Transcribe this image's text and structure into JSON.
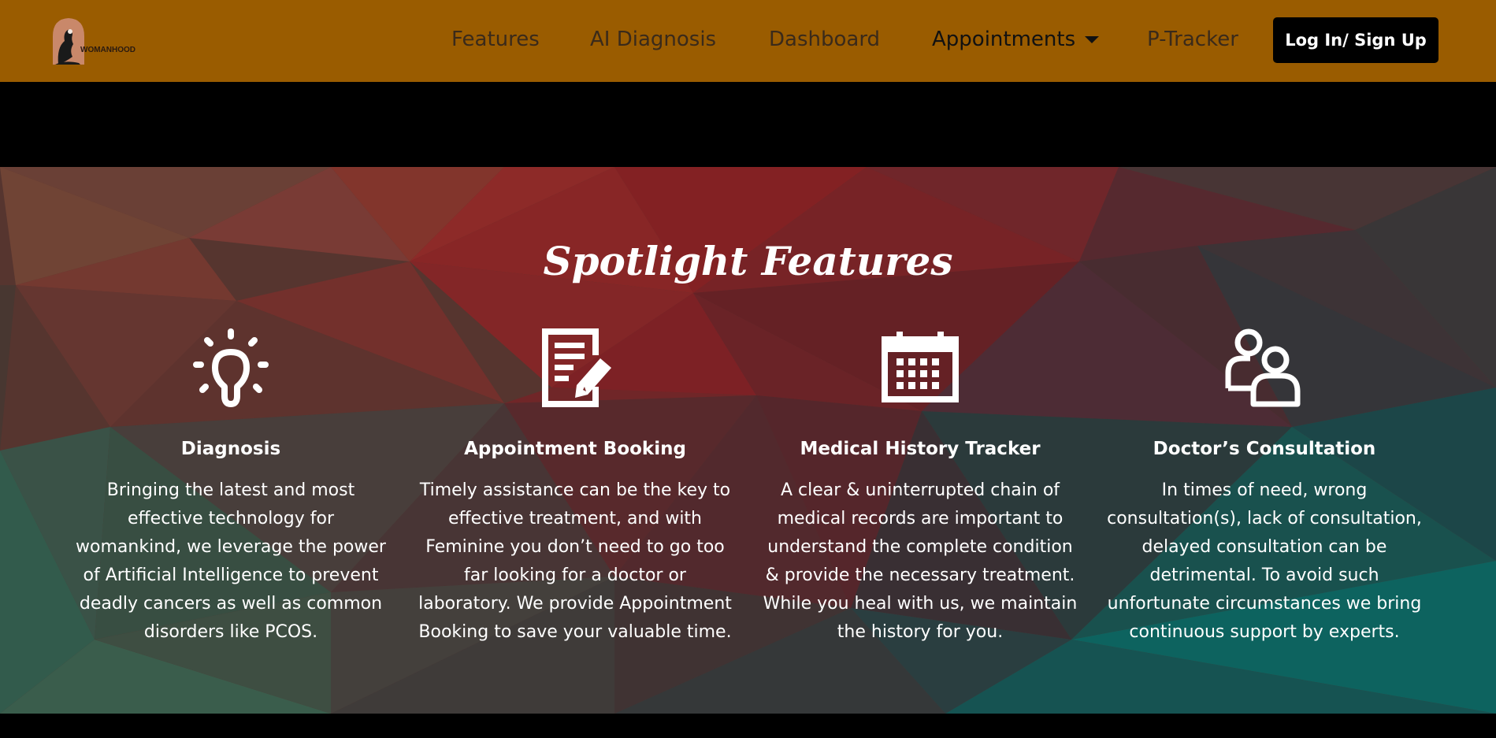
{
  "nav": {
    "logo_text": "WOMANHOOD",
    "links": [
      "Features",
      "AI Diagnosis",
      "Dashboard",
      "Appointments",
      "P-Tracker"
    ],
    "login_label": "Log In/ Sign Up"
  },
  "colors": {
    "nav_bg": "#9a5c00",
    "button_bg": "#000000"
  },
  "features": {
    "title": "Spotlight Features",
    "cards": [
      {
        "icon": "lightbulb-icon",
        "title": "Diagnosis",
        "desc": "Bringing the latest and most effective technology for womankind, we leverage the power of Artificial Intelligence to prevent deadly cancers as well as common disorders like PCOS."
      },
      {
        "icon": "document-edit-icon",
        "title": "Appointment Booking",
        "desc": "Timely assistance can be the key to effective treatment, and with Feminine you don’t need to go too far looking for a doctor or laboratory. We provide Appointment Booking to save your valuable time."
      },
      {
        "icon": "calendar-icon",
        "title": "Medical History Tracker",
        "desc": "A clear & uninterrupted chain of medical records are important to understand the complete condition & provide the necessary treatment. While you heal with us, we maintain the history for you."
      },
      {
        "icon": "users-icon",
        "title": "Doctor’s Consultation",
        "desc": "In times of need, wrong consultation(s), lack of consultation, delayed consultation can be detrimental. To avoid such unfortunate circumstances we bring continuous support by experts."
      }
    ]
  }
}
